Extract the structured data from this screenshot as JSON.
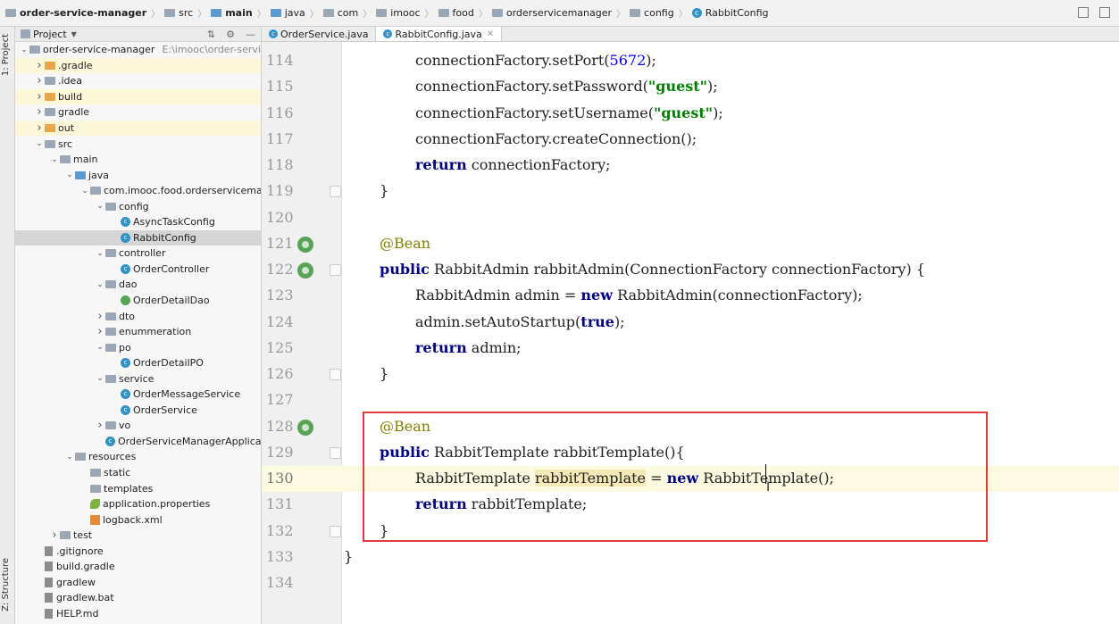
{
  "breadcrumb": [
    {
      "label": "order-service-manager",
      "bold": true,
      "icon": "folder-icon"
    },
    {
      "label": "src",
      "bold": false,
      "icon": "folder-icon"
    },
    {
      "label": "main",
      "bold": true,
      "icon": "folder-icon"
    },
    {
      "label": "java",
      "bold": false,
      "icon": "folder-icon"
    },
    {
      "label": "com",
      "bold": false,
      "icon": "folder-icon"
    },
    {
      "label": "imooc",
      "bold": false,
      "icon": "folder-icon"
    },
    {
      "label": "food",
      "bold": false,
      "icon": "folder-icon"
    },
    {
      "label": "orderservicemanager",
      "bold": false,
      "icon": "folder-icon"
    },
    {
      "label": "config",
      "bold": false,
      "icon": "folder-icon"
    },
    {
      "label": "RabbitConfig",
      "bold": false,
      "icon": "class-icon"
    }
  ],
  "side_labels": {
    "project": "1: Project",
    "structure": "Z: Structure"
  },
  "project_panel": {
    "title": "Project",
    "tree": [
      {
        "label": "order-service-manager",
        "path": "E:\\imooc\\order-service-m",
        "depth": 0,
        "arrow": "down",
        "icon": "folder"
      },
      {
        "label": ".gradle",
        "depth": 1,
        "arrow": "right",
        "icon": "folder-orange",
        "highlight": true
      },
      {
        "label": ".idea",
        "depth": 1,
        "arrow": "right",
        "icon": "folder"
      },
      {
        "label": "build",
        "depth": 1,
        "arrow": "right",
        "icon": "folder-orange",
        "highlight": true
      },
      {
        "label": "gradle",
        "depth": 1,
        "arrow": "right",
        "icon": "folder"
      },
      {
        "label": "out",
        "depth": 1,
        "arrow": "right",
        "icon": "folder-orange",
        "highlight": true
      },
      {
        "label": "src",
        "depth": 1,
        "arrow": "down",
        "icon": "folder"
      },
      {
        "label": "main",
        "depth": 2,
        "arrow": "down",
        "icon": "folder"
      },
      {
        "label": "java",
        "depth": 3,
        "arrow": "down",
        "icon": "folder-blue"
      },
      {
        "label": "com.imooc.food.orderservicemanag",
        "depth": 4,
        "arrow": "down",
        "icon": "folder"
      },
      {
        "label": "config",
        "depth": 5,
        "arrow": "down",
        "icon": "folder"
      },
      {
        "label": "AsyncTaskConfig",
        "depth": 6,
        "arrow": "",
        "icon": "class"
      },
      {
        "label": "RabbitConfig",
        "depth": 6,
        "arrow": "",
        "icon": "class",
        "selected": true
      },
      {
        "label": "controller",
        "depth": 5,
        "arrow": "down",
        "icon": "folder"
      },
      {
        "label": "OrderController",
        "depth": 6,
        "arrow": "",
        "icon": "class"
      },
      {
        "label": "dao",
        "depth": 5,
        "arrow": "down",
        "icon": "folder"
      },
      {
        "label": "OrderDetailDao",
        "depth": 6,
        "arrow": "",
        "icon": "interface"
      },
      {
        "label": "dto",
        "depth": 5,
        "arrow": "right",
        "icon": "folder"
      },
      {
        "label": "enummeration",
        "depth": 5,
        "arrow": "right",
        "icon": "folder"
      },
      {
        "label": "po",
        "depth": 5,
        "arrow": "down",
        "icon": "folder"
      },
      {
        "label": "OrderDetailPO",
        "depth": 6,
        "arrow": "",
        "icon": "class"
      },
      {
        "label": "service",
        "depth": 5,
        "arrow": "down",
        "icon": "folder"
      },
      {
        "label": "OrderMessageService",
        "depth": 6,
        "arrow": "",
        "icon": "class"
      },
      {
        "label": "OrderService",
        "depth": 6,
        "arrow": "",
        "icon": "class"
      },
      {
        "label": "vo",
        "depth": 5,
        "arrow": "right",
        "icon": "folder"
      },
      {
        "label": "OrderServiceManagerApplication",
        "depth": 5,
        "arrow": "",
        "icon": "class"
      },
      {
        "label": "resources",
        "depth": 3,
        "arrow": "down",
        "icon": "folder"
      },
      {
        "label": "static",
        "depth": 4,
        "arrow": "",
        "icon": "folder"
      },
      {
        "label": "templates",
        "depth": 4,
        "arrow": "",
        "icon": "folder"
      },
      {
        "label": "application.properties",
        "depth": 4,
        "arrow": "",
        "icon": "leaf"
      },
      {
        "label": "logback.xml",
        "depth": 4,
        "arrow": "",
        "icon": "xml"
      },
      {
        "label": "test",
        "depth": 2,
        "arrow": "right",
        "icon": "folder"
      },
      {
        "label": ".gitignore",
        "depth": 1,
        "arrow": "",
        "icon": "doc"
      },
      {
        "label": "build.gradle",
        "depth": 1,
        "arrow": "",
        "icon": "doc"
      },
      {
        "label": "gradlew",
        "depth": 1,
        "arrow": "",
        "icon": "doc"
      },
      {
        "label": "gradlew.bat",
        "depth": 1,
        "arrow": "",
        "icon": "doc"
      },
      {
        "label": "HELP.md",
        "depth": 1,
        "arrow": "",
        "icon": "doc"
      }
    ]
  },
  "tabs": [
    {
      "label": "OrderService.java",
      "active": false
    },
    {
      "label": "RabbitConfig.java",
      "active": true
    }
  ],
  "code_lines": [
    {
      "n": "114",
      "indent": 2,
      "tokens": [
        [
          "t",
          "connectionFactory.setPort("
        ],
        [
          "num",
          "5672"
        ],
        [
          "t",
          ");"
        ]
      ]
    },
    {
      "n": "115",
      "indent": 2,
      "tokens": [
        [
          "t",
          "connectionFactory.setPassword("
        ],
        [
          "str",
          "\"guest\""
        ],
        [
          "t",
          ");"
        ]
      ]
    },
    {
      "n": "116",
      "indent": 2,
      "tokens": [
        [
          "t",
          "connectionFactory.setUsername("
        ],
        [
          "str",
          "\"guest\""
        ],
        [
          "t",
          ");"
        ]
      ]
    },
    {
      "n": "117",
      "indent": 2,
      "tokens": [
        [
          "t",
          "connectionFactory.createConnection();"
        ]
      ]
    },
    {
      "n": "118",
      "indent": 2,
      "tokens": [
        [
          "kw",
          "return"
        ],
        [
          "t",
          " connectionFactory;"
        ]
      ]
    },
    {
      "n": "119",
      "indent": 1,
      "tokens": [
        [
          "t",
          "}"
        ]
      ],
      "fold": true
    },
    {
      "n": "120",
      "indent": 0,
      "tokens": []
    },
    {
      "n": "121",
      "indent": 1,
      "tokens": [
        [
          "ann",
          "@Bean"
        ]
      ],
      "gutter_icon": true
    },
    {
      "n": "122",
      "indent": 1,
      "tokens": [
        [
          "kw",
          "public"
        ],
        [
          "t",
          " RabbitAdmin rabbitAdmin(ConnectionFactory connectionFactory) {"
        ]
      ],
      "gutter_icon": true,
      "fold": true
    },
    {
      "n": "123",
      "indent": 2,
      "tokens": [
        [
          "t",
          "RabbitAdmin admin = "
        ],
        [
          "kw",
          "new"
        ],
        [
          "t",
          " RabbitAdmin(connectionFactory);"
        ]
      ]
    },
    {
      "n": "124",
      "indent": 2,
      "tokens": [
        [
          "t",
          "admin.setAutoStartup("
        ],
        [
          "kw",
          "true"
        ],
        [
          "t",
          ");"
        ]
      ]
    },
    {
      "n": "125",
      "indent": 2,
      "tokens": [
        [
          "kw",
          "return"
        ],
        [
          "t",
          " admin;"
        ]
      ]
    },
    {
      "n": "126",
      "indent": 1,
      "tokens": [
        [
          "t",
          "}"
        ]
      ],
      "fold": true
    },
    {
      "n": "127",
      "indent": 0,
      "tokens": []
    },
    {
      "n": "128",
      "indent": 1,
      "tokens": [
        [
          "ann",
          "@Bean"
        ]
      ],
      "gutter_icon": true
    },
    {
      "n": "129",
      "indent": 1,
      "tokens": [
        [
          "kw",
          "public"
        ],
        [
          "t",
          " RabbitTemplate rabbitTemplate(){"
        ]
      ],
      "fold": true
    },
    {
      "n": "130",
      "indent": 2,
      "tokens": [
        [
          "t",
          "RabbitTemplate "
        ],
        [
          "hl",
          "rabbitTemplate"
        ],
        [
          "t",
          " = "
        ],
        [
          "kw",
          "new"
        ],
        [
          "t",
          " RabbitTemplate();"
        ]
      ],
      "current": true
    },
    {
      "n": "131",
      "indent": 2,
      "tokens": [
        [
          "kw",
          "return"
        ],
        [
          "t",
          " rabbitTemplate;"
        ]
      ]
    },
    {
      "n": "132",
      "indent": 1,
      "tokens": [
        [
          "t",
          "}"
        ]
      ],
      "fold": true
    },
    {
      "n": "133",
      "indent": 0,
      "tokens": [
        [
          "t",
          "}"
        ]
      ]
    },
    {
      "n": "134",
      "indent": 0,
      "tokens": []
    }
  ]
}
